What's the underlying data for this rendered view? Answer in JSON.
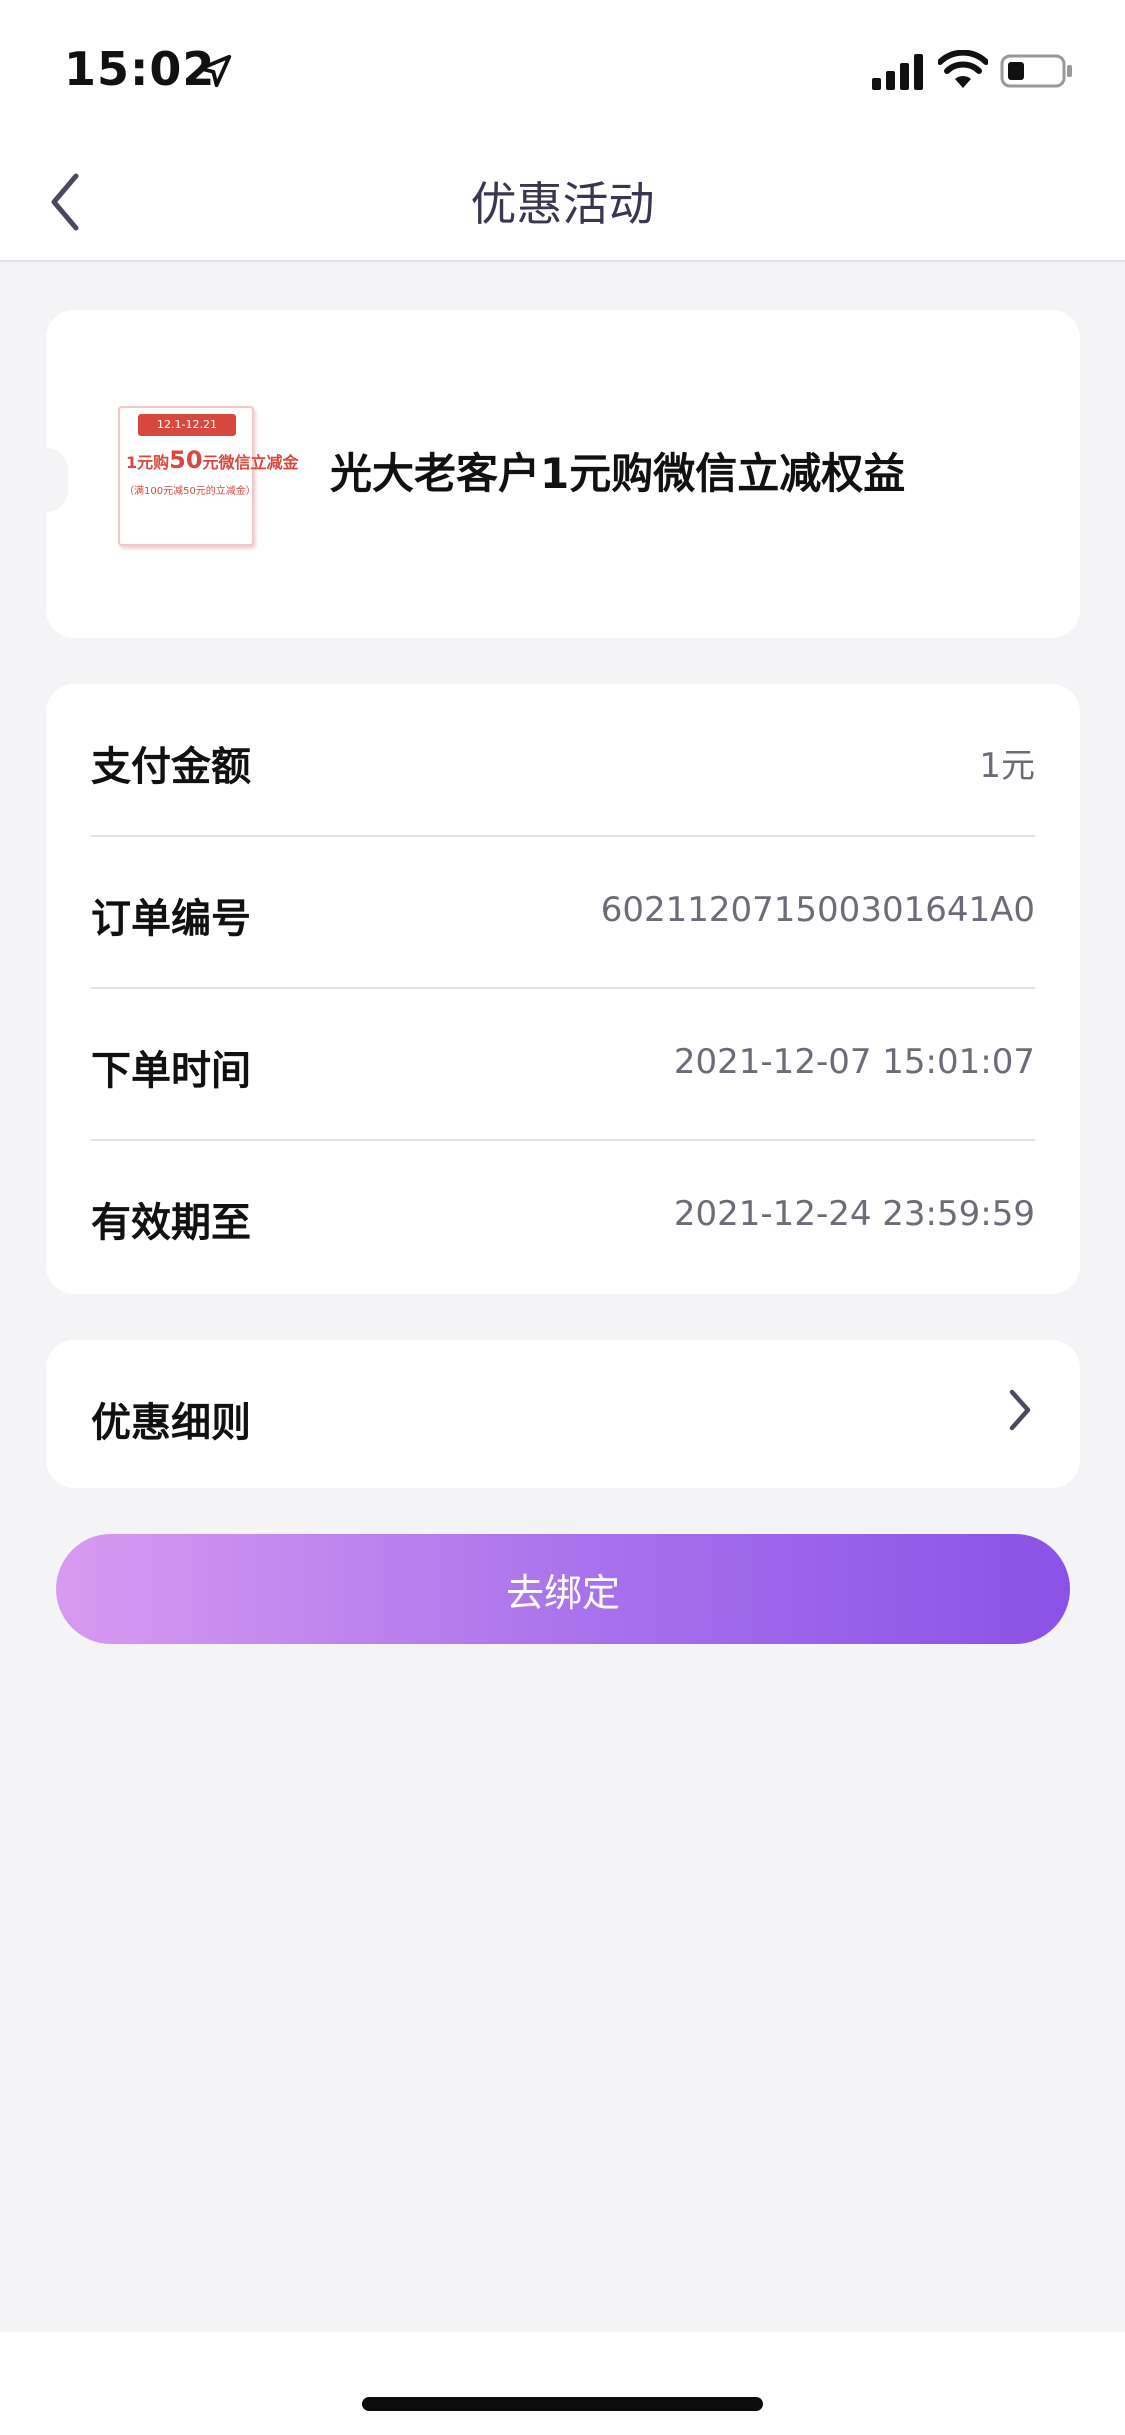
{
  "status_bar": {
    "time": "15:02",
    "icons": [
      "location-arrow-icon",
      "signal-icon",
      "wifi-icon",
      "battery-icon"
    ]
  },
  "nav": {
    "title": "优惠活动",
    "back_icon": "chevron-left-icon"
  },
  "product": {
    "title": "光大老客户1元购微信立减权益",
    "thumbnail": {
      "date_range": "12.1-12.21",
      "main_prefix": "1元购",
      "main_amount": "50",
      "main_suffix": "元微信立减金",
      "sub": "（满100元减50元的立减金）"
    }
  },
  "order_info": {
    "rows": [
      {
        "label": "支付金额",
        "value": "1元"
      },
      {
        "label": "订单编号",
        "value": "602112071500301641A0"
      },
      {
        "label": "下单时间",
        "value": "2021-12-07 15:01:07"
      },
      {
        "label": "有效期至",
        "value": "2021-12-24 23:59:59"
      }
    ]
  },
  "rules": {
    "label": "优惠细则",
    "icon": "chevron-right-icon"
  },
  "action": {
    "bind_label": "去绑定"
  },
  "colors": {
    "background": "#f4f4f6",
    "card": "#ffffff",
    "button_gradient_start": "#d89af0",
    "button_gradient_end": "#8a52e6",
    "value_text": "#6e6a78",
    "coupon_red": "#d8483e"
  }
}
